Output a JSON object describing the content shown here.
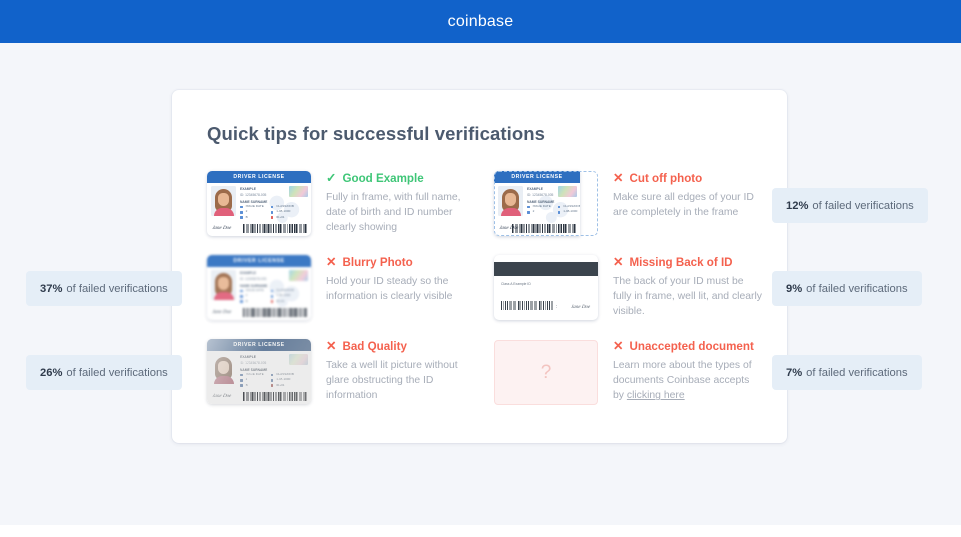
{
  "header": {
    "brand": "coinbase",
    "brand_color": "#1162ca"
  },
  "panel": {
    "title": "Quick tips for successful verifications"
  },
  "id_card_sample": {
    "header_label": "DRIVER LICENSE",
    "name_label": "EXAMPLE",
    "id_line": "ID: 12345678-005",
    "surname_line": "NAME SURNAME",
    "field_a_label": "ISSUE DATE",
    "field_a_value": "2",
    "field_b_label": "EXPIRES",
    "field_b_value": "B",
    "field_c_label": "CLASS/DOB",
    "field_c_value": "1-08-1000",
    "field_d_label": "CLASS/DOB",
    "field_d_value": "1-08-1000",
    "field_e_value": "ID+01",
    "signature": "Jane Doe"
  },
  "id_card_back": {
    "text": "Class A Example ID",
    "divider": ":",
    "signature": "Jane Doe"
  },
  "unaccepted_placeholder": "?",
  "tips": [
    {
      "status": "ok",
      "mark": "check-icon",
      "mark_glyph": "✓",
      "title": "Good Example",
      "body": "Fully in frame, with full name, date of birth and ID number clearly showing",
      "art": "id-front"
    },
    {
      "status": "bad",
      "mark": "cross-icon",
      "mark_glyph": "✕",
      "title": "Cut off photo",
      "body": "Make sure all edges of your ID are completely in the frame",
      "art": "id-front-cut"
    },
    {
      "status": "bad",
      "mark": "cross-icon",
      "mark_glyph": "✕",
      "title": "Blurry Photo",
      "body": "Hold your ID steady so the information is clearly visible",
      "art": "id-front-blurry"
    },
    {
      "status": "bad",
      "mark": "cross-icon",
      "mark_glyph": "✕",
      "title": "Missing Back of ID",
      "body": "The back of your ID must be fully in frame, well lit, and clearly visible.",
      "art": "id-back"
    },
    {
      "status": "bad",
      "mark": "cross-icon",
      "mark_glyph": "✕",
      "title": "Bad Quality",
      "body": "Take a well lit picture without glare obstructing the ID information",
      "art": "id-front-badquality"
    },
    {
      "status": "bad",
      "mark": "cross-icon",
      "mark_glyph": "✕",
      "title": "Unaccepted document",
      "body_pre": "Learn more about the types of documents Coinbase accepts by ",
      "link_text": "clicking here",
      "art": "unaccepted"
    }
  ],
  "badges": {
    "suffix": "of failed verifications",
    "top_right": "12%",
    "mid_left": "37%",
    "mid_right": "9%",
    "bottom_left": "26%",
    "bottom_right": "7%"
  },
  "colors": {
    "page_bg": "#f4f6fa",
    "header_blue": "#1162ca",
    "success_green": "#3ec677",
    "error_red": "#f4614e",
    "badge_bg": "#e5eef7",
    "title_slate": "#4c5a6e"
  }
}
